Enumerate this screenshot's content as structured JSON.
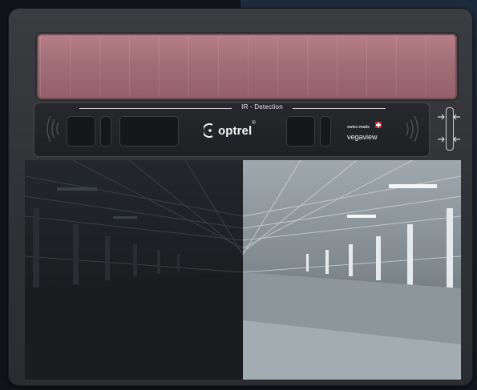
{
  "device": {
    "sensor_label": "IR - Detection",
    "brand": "optrel",
    "brand_mark": "®",
    "swiss_label": "swiss made",
    "product_name": "vegaview"
  },
  "icons": {
    "brand_logo": "optrel-c-logo-icon",
    "swiss_flag": "swiss-flag-icon",
    "adjust": "width-adjust-arrows-icon",
    "signal": "ir-signal-waves-icon"
  },
  "colors": {
    "solar_panel": "#a26e76",
    "housing": "#303236",
    "sensor_bar": "#1e2023",
    "swiss_red": "#d2232a"
  },
  "lens": {
    "left_state": "dark",
    "right_state": "clear"
  }
}
